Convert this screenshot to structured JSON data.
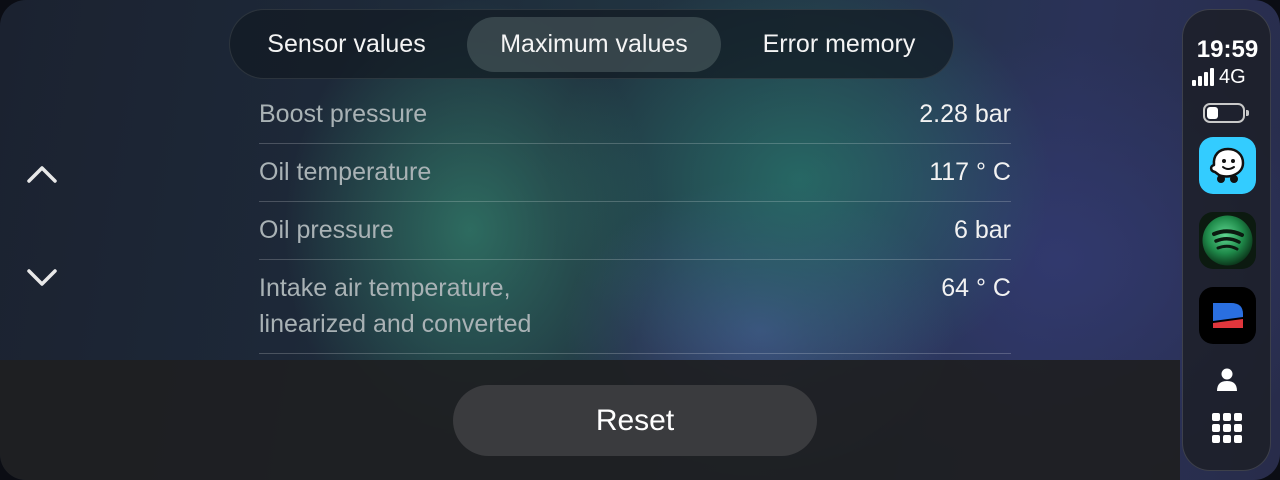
{
  "tabs": [
    {
      "label": "Sensor values",
      "selected": false
    },
    {
      "label": "Maximum values",
      "selected": true
    },
    {
      "label": "Error memory",
      "selected": false
    }
  ],
  "rows": [
    {
      "label": "Boost pressure",
      "value": "2.28 bar"
    },
    {
      "label": "Oil temperature",
      "value": "117 ° C"
    },
    {
      "label": "Oil pressure",
      "value": "6 bar"
    },
    {
      "label": "Intake air temperature,\nlinearized and converted",
      "value": "64 ° C"
    }
  ],
  "nav": {
    "up_icon": "chevron-up-icon",
    "down_icon": "chevron-down-icon"
  },
  "reset_label": "Reset",
  "status": {
    "time": "19:59",
    "network": "4G",
    "signal_bars": 4,
    "battery_level": 0.25
  },
  "dock_apps": [
    "waze-app-icon",
    "spotify-app-icon",
    "car-app-icon"
  ],
  "colors": {
    "waze": "#33ccff",
    "spotify": "#1db954",
    "label": "#a9b2b5",
    "value": "#f2f2f2"
  }
}
